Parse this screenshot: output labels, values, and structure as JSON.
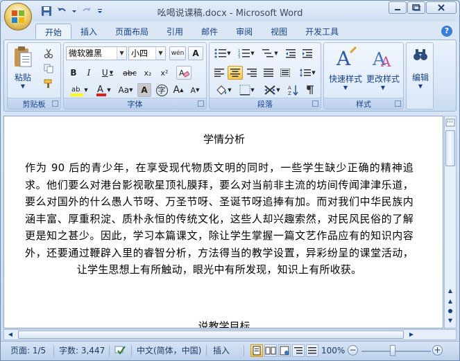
{
  "window": {
    "title": "吆喝说课稿.docx - Microsoft Word"
  },
  "tabs": [
    "开始",
    "插入",
    "页面布局",
    "引用",
    "邮件",
    "审阅",
    "视图",
    "开发工具"
  ],
  "ribbon": {
    "clipboard": {
      "label": "剪贴板",
      "paste": "粘贴"
    },
    "font": {
      "label": "字体",
      "name": "微软雅黑",
      "size": "小四",
      "bold": "B",
      "italic": "I",
      "underline": "U",
      "strike": "abc",
      "sub": "x₂",
      "sup": "x²",
      "clear": "Aa",
      "grow": "A",
      "shrink": "A",
      "char_border": "A",
      "color_a": "A",
      "wen": "wén",
      "zi": "字"
    },
    "paragraph": {
      "label": "段落"
    },
    "styles": {
      "label": "样式",
      "quick": "快速样式",
      "change": "更改样式"
    },
    "editing": {
      "label": "编辑"
    }
  },
  "document": {
    "heading": "学情分析",
    "paragraph": "作为 90 后的青少年，在享受现代物质文明的同时，一些学生缺少正确的精神追求。他们要么对港台影视歌星顶礼膜拜，要么对当前非主流的坊间传闻津津乐道，要么对国外的什么愚人节呀、万圣节呀、圣诞节呀追捧有加。而对我们中华民族内涵丰富、厚重积淀、质朴永恒的传统文化，这些人却兴趣索然，对民风民俗的了解更是知之甚少。因此，学习本篇课文，除让学生掌握一篇文艺作品应有的知识内容外，还要通过鞭辟入里的睿智分析，方法得当的教学设置，异彩纷呈的课堂活动，让学生思想上有所触动，眼光中有所发现，知识上有所收获。",
    "next_heading": "说教学目标"
  },
  "status": {
    "page": "页面: 1/5",
    "words": "字数: 3,447",
    "language": "中文(简体，中国)",
    "mode": "插入",
    "zoom": "100%"
  }
}
